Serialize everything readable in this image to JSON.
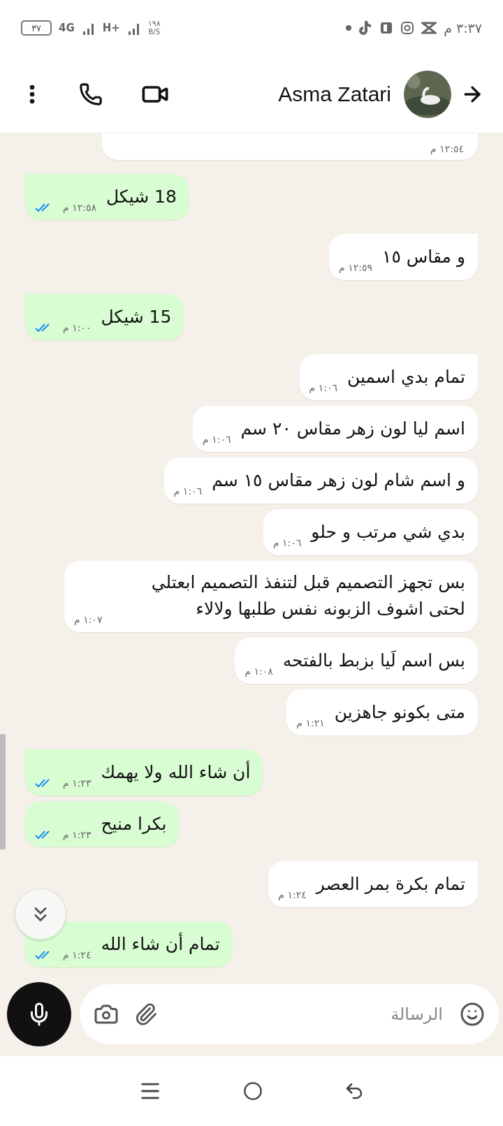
{
  "status_bar": {
    "time": "٣:٣٧ م",
    "battery": "٣٧",
    "network_1": "4G",
    "network_2": "H+",
    "speed": "١٩٨",
    "speed_unit": "B/S"
  },
  "header": {
    "contact_name": "Asma Zatari"
  },
  "messages": [
    {
      "kind": "in",
      "time": "١٢:٥٤ م",
      "partial": true
    },
    {
      "kind": "out",
      "text": "18 شيكل",
      "time": "١٢:٥٨ م",
      "read": true
    },
    {
      "kind": "in",
      "text": "و مقاس ١٥",
      "time": "١٢:٥٩ م"
    },
    {
      "kind": "out",
      "text": "15 شيكل",
      "time": "١:٠٠ م",
      "read": true
    },
    {
      "kind": "in",
      "text": "تمام بدي اسمين",
      "time": "١:٠٦ م"
    },
    {
      "kind": "in",
      "text": "اسم ليا لون زهر مقاس ٢٠ سم",
      "time": "١:٠٦ م"
    },
    {
      "kind": "in",
      "text": "و اسم شام لون زهر مقاس ١٥ سم",
      "time": "١:٠٦ م"
    },
    {
      "kind": "in",
      "text": "بدي شي مرتب و حلو",
      "time": "١:٠٦ م"
    },
    {
      "kind": "in",
      "text": "بس تجهز التصميم قبل لتنفذ التصميم ابعتلي لحتى اشوف الزبونه نفس طلبها ولالاء",
      "time": "١:٠٧ م"
    },
    {
      "kind": "in",
      "text": "بس اسم لَيا بزبط بالفتحه",
      "time": "١:٠٨ م"
    },
    {
      "kind": "in",
      "text": "متى بكونو جاهزين",
      "time": "١:٢١ م"
    },
    {
      "kind": "out",
      "text": "أن شاء الله ولا يهمك",
      "time": "١:٢٣ م",
      "read": true
    },
    {
      "kind": "out",
      "text": "بكرا منيح",
      "time": "١:٢٣ م",
      "read": true
    },
    {
      "kind": "in",
      "text": "تمام بكرة بمر العصر",
      "time": "١:٢٤ م"
    },
    {
      "kind": "out",
      "text": "تمام أن شاء الله",
      "time": "١:٢٤ م",
      "read": true
    }
  ],
  "composer": {
    "placeholder": "الرسالة"
  }
}
